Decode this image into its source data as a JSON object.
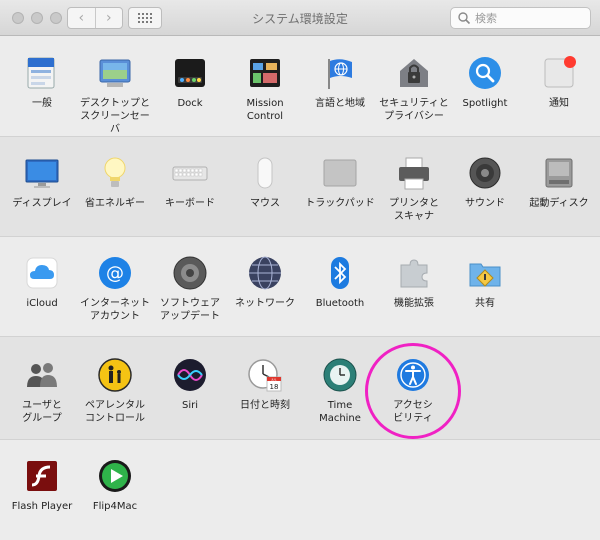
{
  "window": {
    "title": "システム環境設定",
    "search_placeholder": "検索",
    "nav_back": "‹",
    "nav_forward": "›"
  },
  "sections": [
    {
      "items": [
        {
          "id": "general",
          "label": "一般",
          "icon": "general-icon"
        },
        {
          "id": "desktop",
          "label": "デスクトップと\nスクリーンセーバ",
          "icon": "desktop-screensaver-icon"
        },
        {
          "id": "dock",
          "label": "Dock",
          "icon": "dock-icon"
        },
        {
          "id": "mission",
          "label": "Mission\nControl",
          "icon": "mission-control-icon"
        },
        {
          "id": "language",
          "label": "言語と地域",
          "icon": "language-region-icon"
        },
        {
          "id": "security",
          "label": "セキュリティと\nプライバシー",
          "icon": "security-privacy-icon"
        },
        {
          "id": "spotlight",
          "label": "Spotlight",
          "icon": "spotlight-icon"
        },
        {
          "id": "notifications",
          "label": "通知",
          "icon": "notifications-icon"
        }
      ]
    },
    {
      "items": [
        {
          "id": "displays",
          "label": "ディスプレイ",
          "icon": "displays-icon"
        },
        {
          "id": "energy",
          "label": "省エネルギー",
          "icon": "energy-saver-icon"
        },
        {
          "id": "keyboard",
          "label": "キーボード",
          "icon": "keyboard-icon"
        },
        {
          "id": "mouse",
          "label": "マウス",
          "icon": "mouse-icon"
        },
        {
          "id": "trackpad",
          "label": "トラックパッド",
          "icon": "trackpad-icon"
        },
        {
          "id": "printers",
          "label": "プリンタと\nスキャナ",
          "icon": "printers-scanners-icon"
        },
        {
          "id": "sound",
          "label": "サウンド",
          "icon": "sound-icon"
        },
        {
          "id": "startup",
          "label": "起動ディスク",
          "icon": "startup-disk-icon"
        }
      ]
    },
    {
      "items": [
        {
          "id": "icloud",
          "label": "iCloud",
          "icon": "icloud-icon"
        },
        {
          "id": "internet",
          "label": "インターネット\nアカウント",
          "icon": "internet-accounts-icon"
        },
        {
          "id": "software",
          "label": "ソフトウェア\nアップデート",
          "icon": "software-update-icon"
        },
        {
          "id": "network",
          "label": "ネットワーク",
          "icon": "network-icon"
        },
        {
          "id": "bluetooth",
          "label": "Bluetooth",
          "icon": "bluetooth-icon"
        },
        {
          "id": "extensions",
          "label": "機能拡張",
          "icon": "extensions-icon"
        },
        {
          "id": "sharing",
          "label": "共有",
          "icon": "sharing-icon"
        }
      ]
    },
    {
      "items": [
        {
          "id": "users",
          "label": "ユーザと\nグループ",
          "icon": "users-groups-icon"
        },
        {
          "id": "parental",
          "label": "ペアレンタル\nコントロール",
          "icon": "parental-controls-icon"
        },
        {
          "id": "siri",
          "label": "Siri",
          "icon": "siri-icon"
        },
        {
          "id": "datetime",
          "label": "日付と時刻",
          "icon": "date-time-icon"
        },
        {
          "id": "timemachine",
          "label": "Time\nMachine",
          "icon": "time-machine-icon"
        },
        {
          "id": "accessibility",
          "label": "アクセシ\nビリティ",
          "icon": "accessibility-icon"
        }
      ]
    },
    {
      "items": [
        {
          "id": "flash",
          "label": "Flash Player",
          "icon": "flash-player-icon"
        },
        {
          "id": "flip4mac",
          "label": "Flip4Mac",
          "icon": "flip4mac-icon"
        }
      ]
    }
  ],
  "dock_date": {
    "month": "JUL",
    "day": "18"
  },
  "highlighted_item": "accessibility",
  "colors": {
    "highlight": "#f021c4",
    "notification_badge": "#ff3b30"
  }
}
